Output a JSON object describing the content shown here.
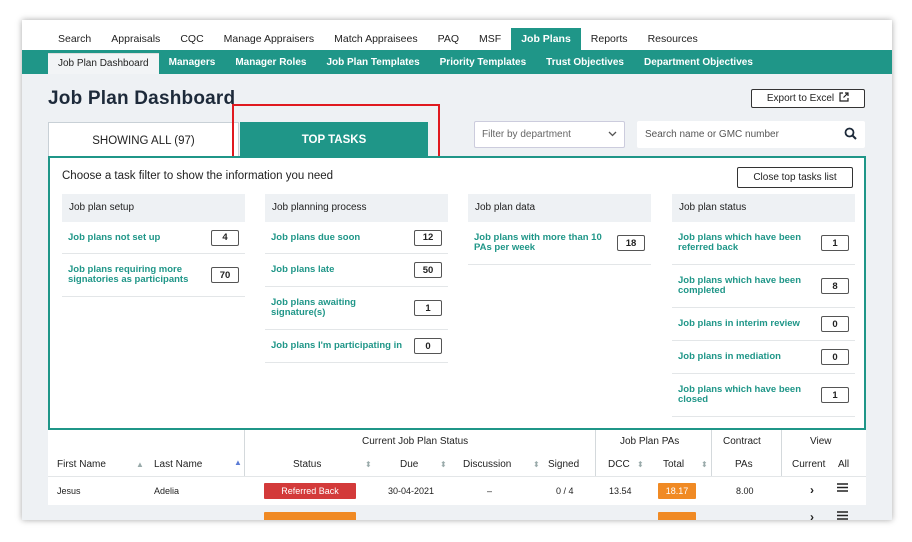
{
  "topnav": {
    "items": [
      {
        "label": "Search",
        "active": false
      },
      {
        "label": "Appraisals",
        "active": false
      },
      {
        "label": "CQC",
        "active": false
      },
      {
        "label": "Manage Appraisers",
        "active": false
      },
      {
        "label": "Match Appraisees",
        "active": false
      },
      {
        "label": "PAQ",
        "active": false
      },
      {
        "label": "MSF",
        "active": false
      },
      {
        "label": "Job Plans",
        "active": true
      },
      {
        "label": "Reports",
        "active": false
      },
      {
        "label": "Resources",
        "active": false
      }
    ]
  },
  "subnav": {
    "items": [
      {
        "label": "Job Plan Dashboard",
        "active": true
      },
      {
        "label": "Managers",
        "active": false
      },
      {
        "label": "Manager Roles",
        "active": false
      },
      {
        "label": "Job Plan Templates",
        "active": false
      },
      {
        "label": "Priority Templates",
        "active": false
      },
      {
        "label": "Trust Objectives",
        "active": false
      },
      {
        "label": "Department Objectives",
        "active": false
      }
    ]
  },
  "page": {
    "title": "Job Plan Dashboard",
    "export_label": "Export to Excel",
    "tab_all": "SHOWING ALL (97)",
    "tab_top": "TOP TASKS",
    "filter_placeholder": "Filter by department",
    "search_placeholder": "Search name or GMC number"
  },
  "panel": {
    "prompt": "Choose a task filter to show the information you need",
    "close_label": "Close top tasks list",
    "columns": [
      {
        "heading": "Job plan setup",
        "rows": [
          {
            "label": "Job plans not set up",
            "count": "4"
          },
          {
            "label": "Job plans requiring more signatories as participants",
            "count": "70"
          }
        ]
      },
      {
        "heading": "Job planning process",
        "rows": [
          {
            "label": "Job plans due soon",
            "count": "12"
          },
          {
            "label": "Job plans late",
            "count": "50"
          },
          {
            "label": "Job plans awaiting signature(s)",
            "count": "1"
          },
          {
            "label": "Job plans I'm participating in",
            "count": "0"
          }
        ]
      },
      {
        "heading": "Job plan data",
        "rows": [
          {
            "label": "Job plans with more than 10 PAs per week",
            "count": "18"
          }
        ]
      },
      {
        "heading": "Job plan status",
        "rows": [
          {
            "label": "Job plans which have been referred back",
            "count": "1"
          },
          {
            "label": "Job plans which have been completed",
            "count": "8"
          },
          {
            "label": "Job plans in interim review",
            "count": "0"
          },
          {
            "label": "Job plans in mediation",
            "count": "0"
          },
          {
            "label": "Job plans which have been closed",
            "count": "1"
          }
        ]
      }
    ]
  },
  "table": {
    "group_headers": {
      "status": "Current Job Plan Status",
      "pas": "Job Plan PAs",
      "contract": "Contract",
      "view": "View"
    },
    "headers": {
      "first_name": "First Name",
      "last_name": "Last Name",
      "status": "Status",
      "due": "Due",
      "discussion": "Discussion",
      "signed": "Signed",
      "dcc": "DCC",
      "total": "Total",
      "pas": "PAs",
      "current": "Current",
      "all": "All"
    },
    "rows": [
      {
        "first_name": "Jesus",
        "last_name": "Adelia",
        "status": "Referred Back",
        "due": "30-04-2021",
        "discussion": "–",
        "signed": "0 / 4",
        "dcc": "13.54",
        "total": "18.17",
        "pas": "8.00"
      }
    ]
  },
  "colors": {
    "brand": "#1f9688",
    "highlight": "#e0191f",
    "badge_referred": "#d33a3a",
    "badge_total": "#f08a24"
  }
}
